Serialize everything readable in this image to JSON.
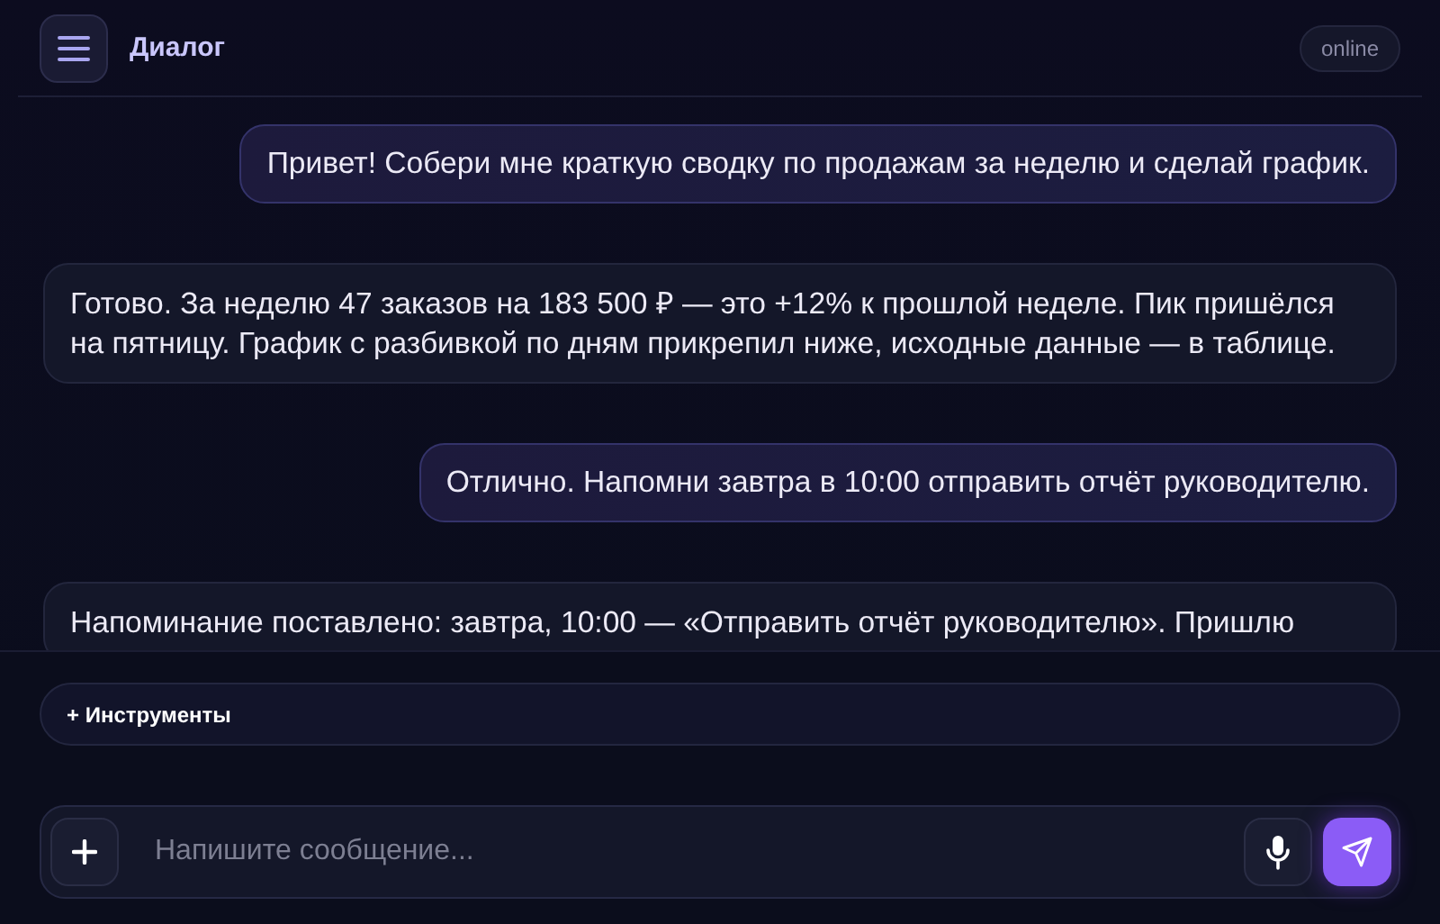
{
  "header": {
    "title": "Диалог",
    "status": "online"
  },
  "messages": [
    {
      "kind": "user",
      "text": "Привет! Собери мне краткую сводку по продажам за неделю и сделай график."
    },
    {
      "kind": "assistant",
      "text": "Готово. За неделю 47 заказов на 183 500 ₽ — это +12% к прошлой неделе. Пик пришёлся на пятницу. График с разбивкой по дням прикрепил ниже, исходные данные — в таблице."
    },
    {
      "kind": "user",
      "text": "Отлично. Напомни завтра в 10:00 отправить отчёт руководителю."
    },
    {
      "kind": "assistant",
      "text": "Напоминание поставлено: завтра, 10:00 — «Отправить отчёт руководителю». Пришлю"
    }
  ],
  "tools_button": "+ Инструменты",
  "composer": {
    "placeholder": "Напишите сообщение..."
  }
}
